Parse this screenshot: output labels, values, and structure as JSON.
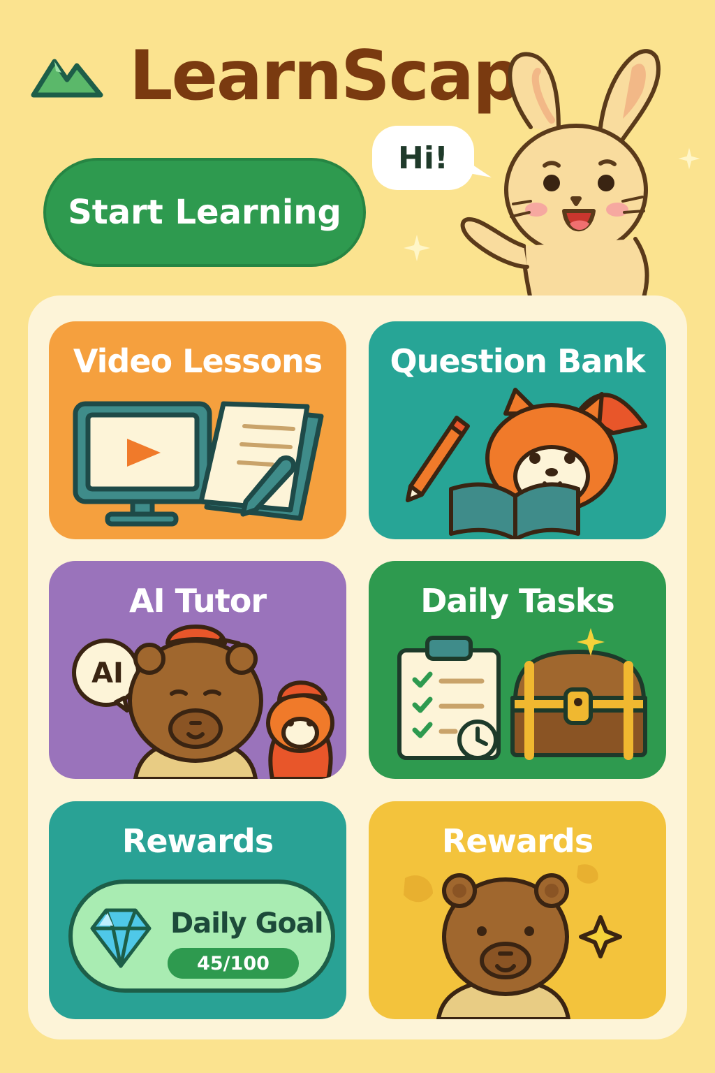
{
  "app": {
    "name": "LearnScap"
  },
  "hero": {
    "start_label": "Start Learning",
    "greeting": "Hi!"
  },
  "cards": [
    {
      "title": "Video Lessons"
    },
    {
      "title": "Question Bank"
    },
    {
      "title": "AI Tutor",
      "badge": "AI"
    },
    {
      "title": "Daily Tasks"
    },
    {
      "title": "Rewards",
      "goal_label": "Daily Goal",
      "goal_value": "45/100",
      "goal_progress": 0.45
    },
    {
      "title": "Rewards"
    }
  ],
  "colors": {
    "background": "#fbe38f",
    "brand": "#7a3a10",
    "primary": "#2e9a4f",
    "orange": "#f5a03e",
    "teal": "#27a596",
    "purple": "#9a73bb",
    "yellow": "#f3c33c"
  },
  "icons": [
    "mountain-logo-icon",
    "bunny-mascot",
    "monitor-icon",
    "notebook-icon",
    "red-panda-icon",
    "pencil-icon",
    "capybara-icon",
    "clipboard-icon",
    "treasure-chest-icon",
    "gem-icon",
    "bear-icon",
    "sparkle-icon"
  ]
}
